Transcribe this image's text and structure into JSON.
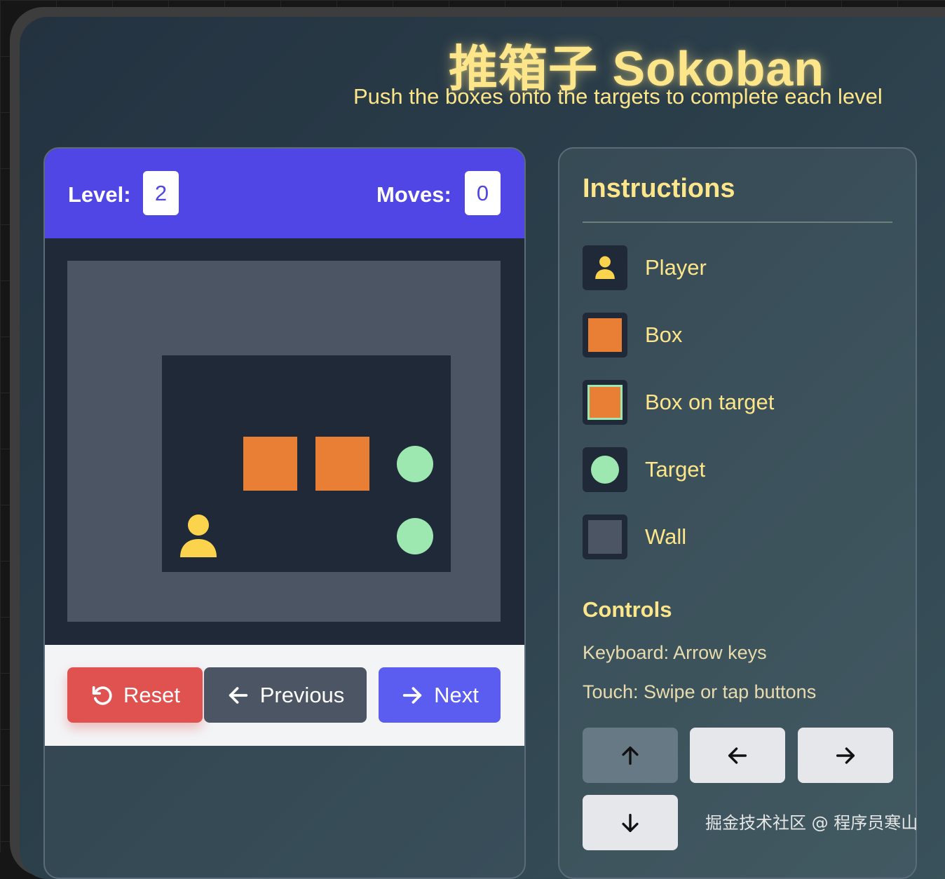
{
  "header": {
    "title": "推箱子 Sokoban",
    "subtitle": "Push the boxes onto the targets to complete each level"
  },
  "stats": {
    "level_label": "Level:",
    "level_value": "2",
    "moves_label": "Moves:",
    "moves_value": "0"
  },
  "board": {
    "floor": [
      [
        "floor",
        "floor",
        "floor",
        "floor"
      ],
      [
        "floor",
        "box",
        "box",
        "target"
      ],
      [
        "player",
        "floor",
        "floor",
        "target"
      ]
    ]
  },
  "buttons": {
    "reset": "Reset",
    "previous": "Previous",
    "next": "Next"
  },
  "instructions": {
    "heading": "Instructions",
    "legend": [
      {
        "key": "player",
        "label": "Player"
      },
      {
        "key": "box",
        "label": "Box"
      },
      {
        "key": "box-on-target",
        "label": "Box on target"
      },
      {
        "key": "target",
        "label": "Target"
      },
      {
        "key": "wall",
        "label": "Wall"
      }
    ]
  },
  "controls": {
    "heading": "Controls",
    "keyboard": "Keyboard: Arrow keys",
    "touch": "Touch: Swipe or tap buttons",
    "pad": [
      "arrow-up-icon",
      "arrow-left-icon",
      "arrow-right-icon",
      "arrow-down-icon"
    ]
  },
  "watermark": "掘金技术社区 @ 程序员寒山",
  "colors": {
    "header": "#4f46e5",
    "title": "#fde68a",
    "box": "#e97e35",
    "target": "#9de8b0",
    "player": "#fcd34d",
    "wall": "#4b5563",
    "floor": "#1f2937",
    "reset": "#e0524f",
    "previous": "#4b5563",
    "next": "#5b5cf0"
  }
}
